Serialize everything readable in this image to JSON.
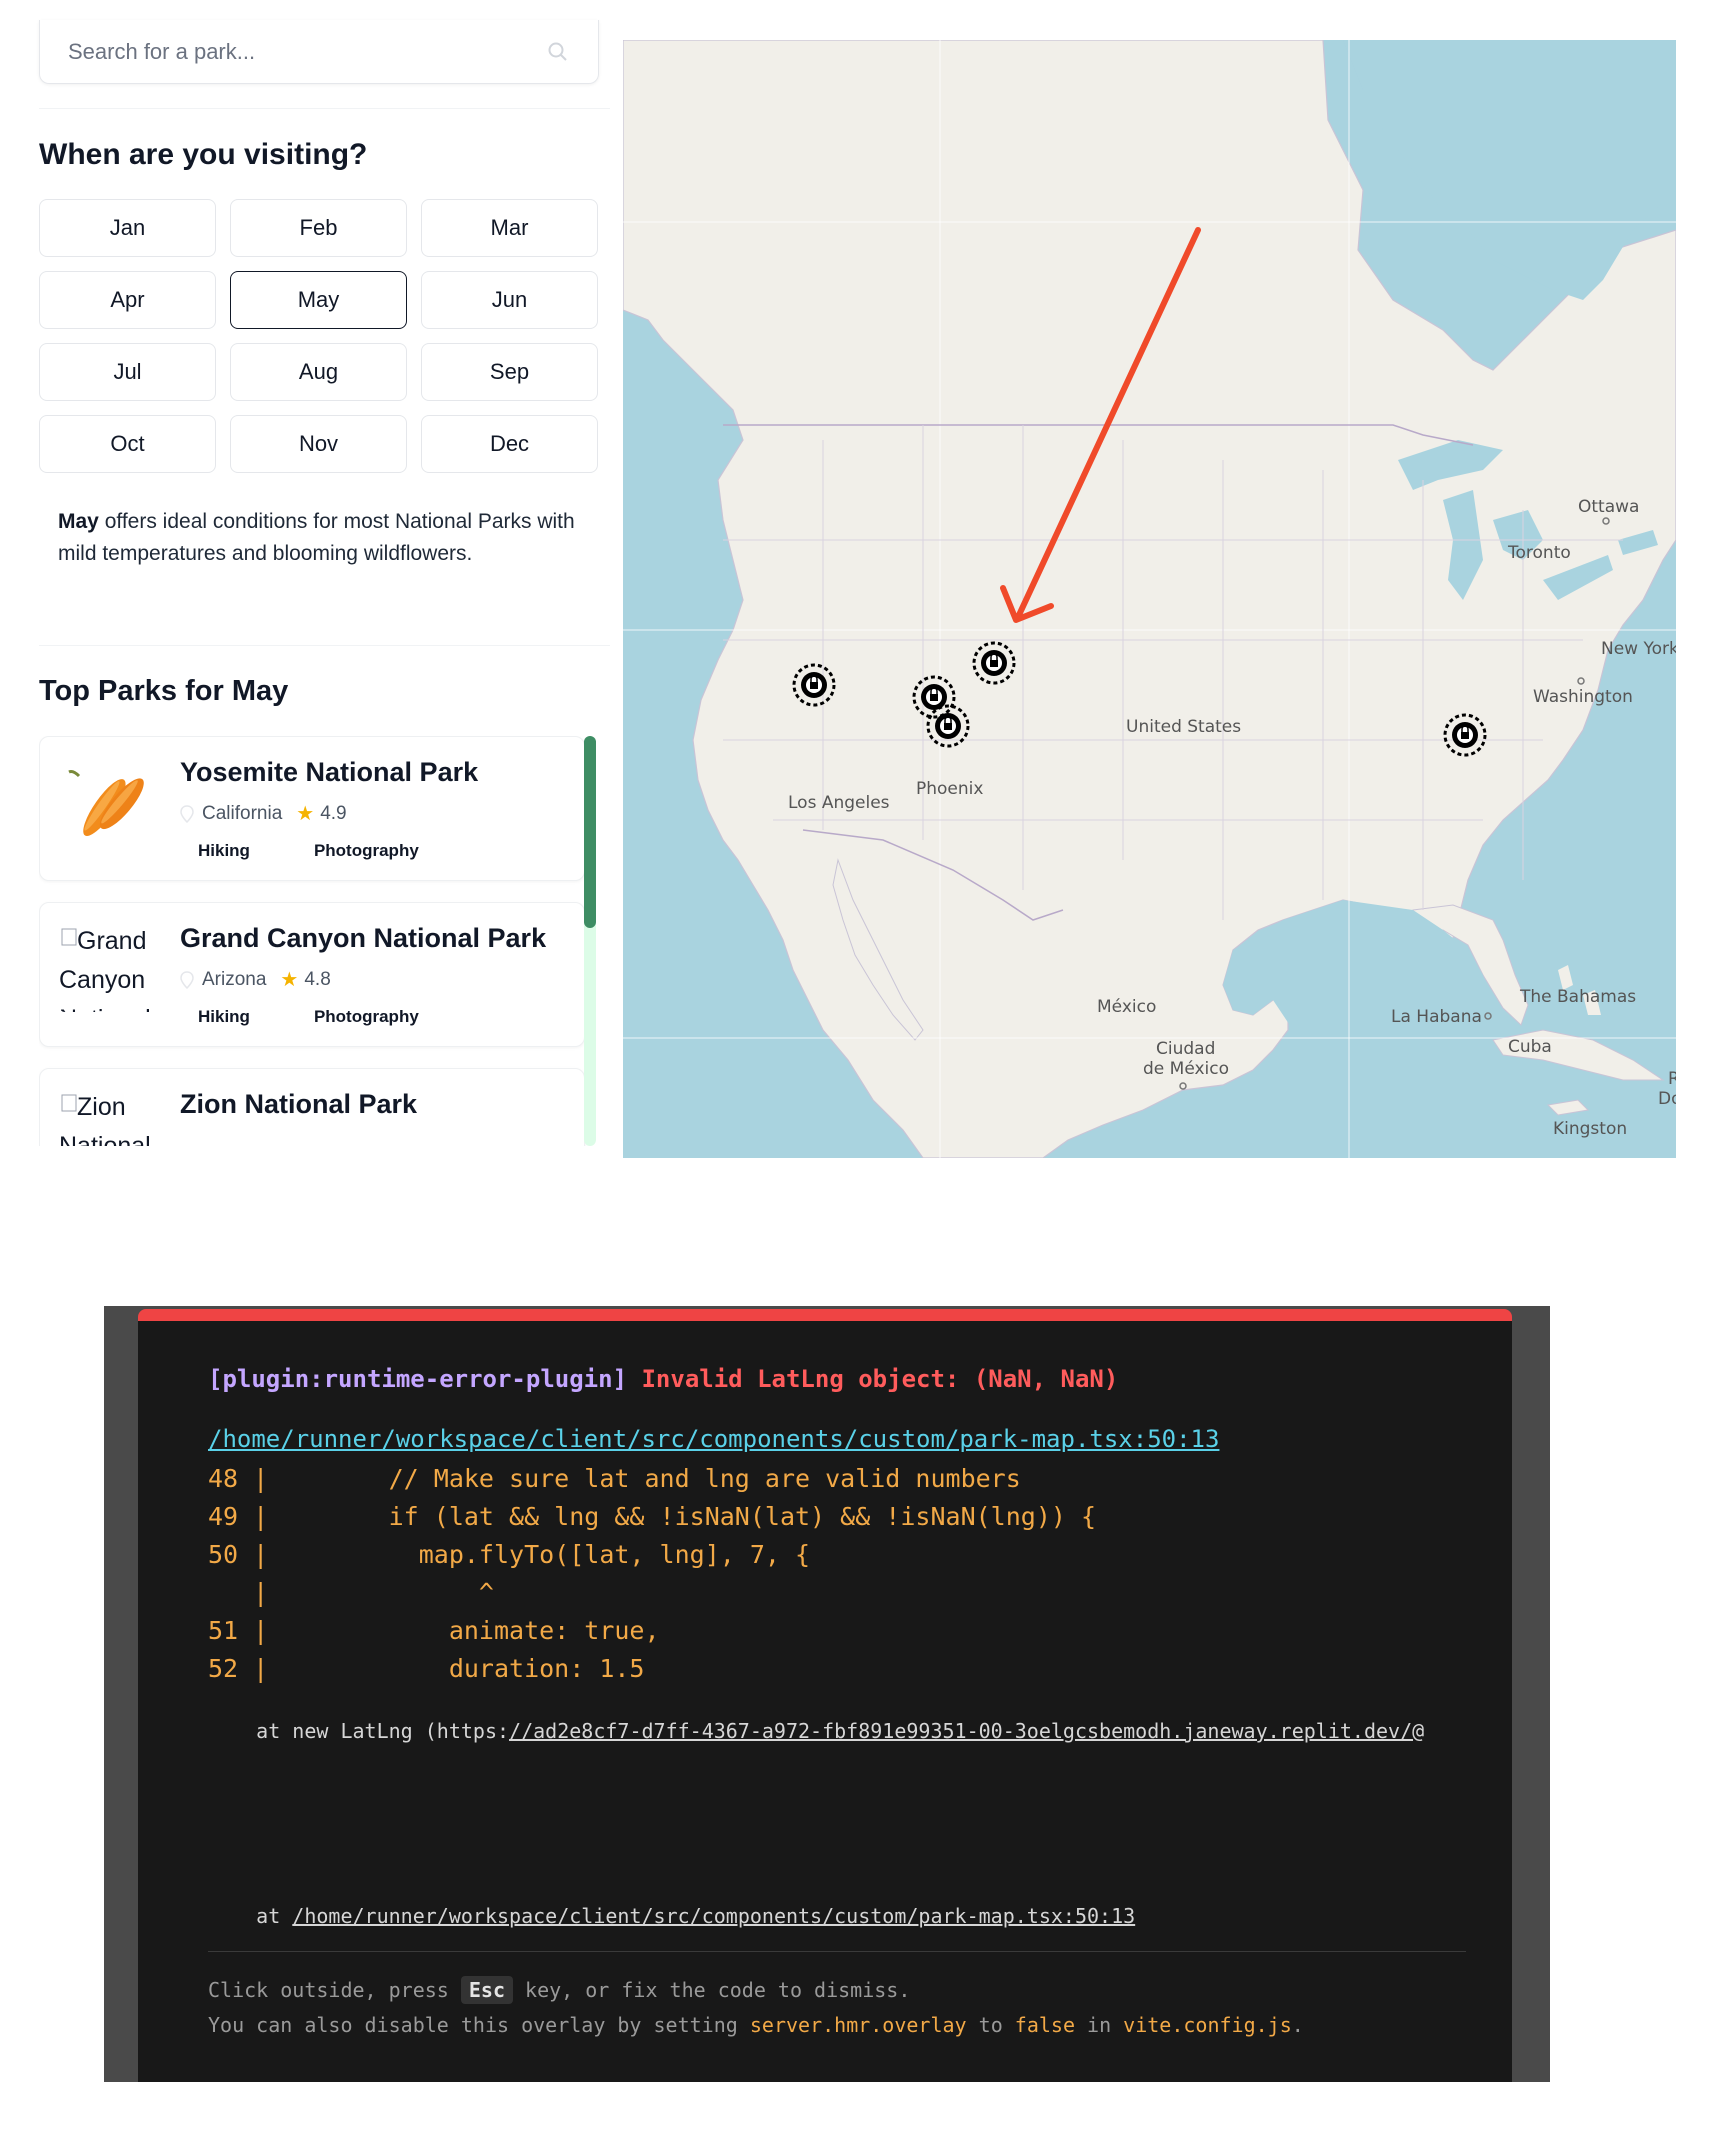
{
  "search": {
    "placeholder": "Search for a park..."
  },
  "visit": {
    "heading": "When are you visiting?",
    "months": [
      "Jan",
      "Feb",
      "Mar",
      "Apr",
      "May",
      "Jun",
      "Jul",
      "Aug",
      "Sep",
      "Oct",
      "Nov",
      "Dec"
    ],
    "selected": "May"
  },
  "description": {
    "month": "May",
    "text": " offers ideal conditions for most National Parks with mild temperatures and blooming wildflowers."
  },
  "top_parks": {
    "heading": "Top Parks for May",
    "parks": [
      {
        "name": "Yosemite National Park",
        "state": "California",
        "rating": "4.9",
        "tags": [
          "Hiking",
          "Photography"
        ],
        "image_alt": ""
      },
      {
        "name": "Grand Canyon National Park",
        "state": "Arizona",
        "rating": "4.8",
        "tags": [
          "Hiking",
          "Photography"
        ],
        "image_alt": "Grand Canyon National"
      },
      {
        "name": "Zion National Park",
        "state": "",
        "rating": "",
        "tags": [],
        "image_alt": "Zion National"
      }
    ]
  },
  "map": {
    "labels": {
      "ottawa": "Ottawa",
      "toronto": "Toronto",
      "new_york": "New York",
      "washington": "Washington",
      "united_states": "United States",
      "los_angeles": "Los Angeles",
      "phoenix": "Phoenix",
      "mexico": "México",
      "ciudad1": "Ciudad",
      "ciudad2": "de México",
      "la_habana": "La Habana",
      "the_bahamas": "The Bahamas",
      "cuba": "Cuba",
      "kingston": "Kingston",
      "r": "R",
      "d": "Do"
    },
    "arrow_color": "#f04a2a"
  },
  "error_overlay": {
    "plugin": "[plugin:runtime-error-plugin]",
    "message": "Invalid LatLng object: (NaN, NaN)",
    "file_link": "/home/runner/workspace/client/src/components/custom/park-map.tsx:50:13",
    "code_lines": [
      "48 |        // Make sure lat and lng are valid numbers",
      "49 |        if (lat && lng && !isNaN(lat) && !isNaN(lng)) {",
      "50 |          map.flyTo([lat, lng], 7, {",
      "   |              ^",
      "51 |            animate: true,",
      "52 |            duration: 1.5"
    ],
    "stack_1_prefix": "    at new LatLng (https:",
    "stack_1_link": "//ad2e8cf7-d7ff-4367-a972-fbf891e99351-00-3oelgcsbemodh.janeway.replit.dev/@",
    "stack_2_prefix": "    at ",
    "stack_2_link": "/home/runner/workspace/client/src/components/custom/park-map.tsx:50:13",
    "tip_1_a": "Click outside, press ",
    "tip_1_key": "Esc",
    "tip_1_b": " key, or fix the code to dismiss.",
    "tip_2_a": "You can also disable this overlay by setting ",
    "tip_2_setting": "server.hmr.overlay",
    "tip_2_b": " to ",
    "tip_2_value": "false",
    "tip_2_c": " in ",
    "tip_2_file": "vite.config.js",
    "tip_2_d": ".",
    "accent": "#ef4444"
  }
}
